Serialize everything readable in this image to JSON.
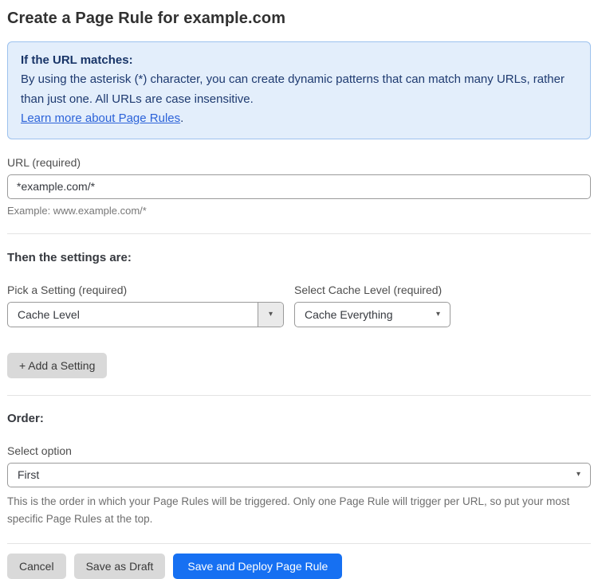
{
  "page": {
    "title": "Create a Page Rule for example.com"
  },
  "info_box": {
    "heading": "If the URL matches:",
    "body": "By using the asterisk (*) character, you can create dynamic patterns that can match many URLs, rather than just one. All URLs are case insensitive.",
    "link_label": "Learn more about Page Rules",
    "link_suffix": "."
  },
  "url_field": {
    "label": "URL (required)",
    "value": "*example.com/*",
    "helper": "Example: www.example.com/*"
  },
  "settings": {
    "heading": "Then the settings are:",
    "setting_picker": {
      "label": "Pick a Setting (required)",
      "value": "Cache Level"
    },
    "cache_level_picker": {
      "label": "Select Cache Level (required)",
      "value": "Cache Everything"
    },
    "add_setting_label": "+ Add a Setting"
  },
  "order": {
    "heading": "Order:",
    "label": "Select option",
    "value": "First",
    "helper": "This is the order in which your Page Rules will be triggered. Only one Page Rule will trigger per URL, so put your most specific Page Rules at the top."
  },
  "actions": {
    "cancel_label": "Cancel",
    "save_draft_label": "Save as Draft",
    "save_deploy_label": "Save and Deploy Page Rule"
  },
  "icons": {
    "caret_glyph": "▾"
  },
  "colors": {
    "primary_button": "#1670f2",
    "info_box_background": "#e3eefb",
    "info_box_border": "#9dc2ee",
    "info_text": "#1e3a70",
    "link": "#2c63d9",
    "gray_button": "#d9d9d9"
  }
}
